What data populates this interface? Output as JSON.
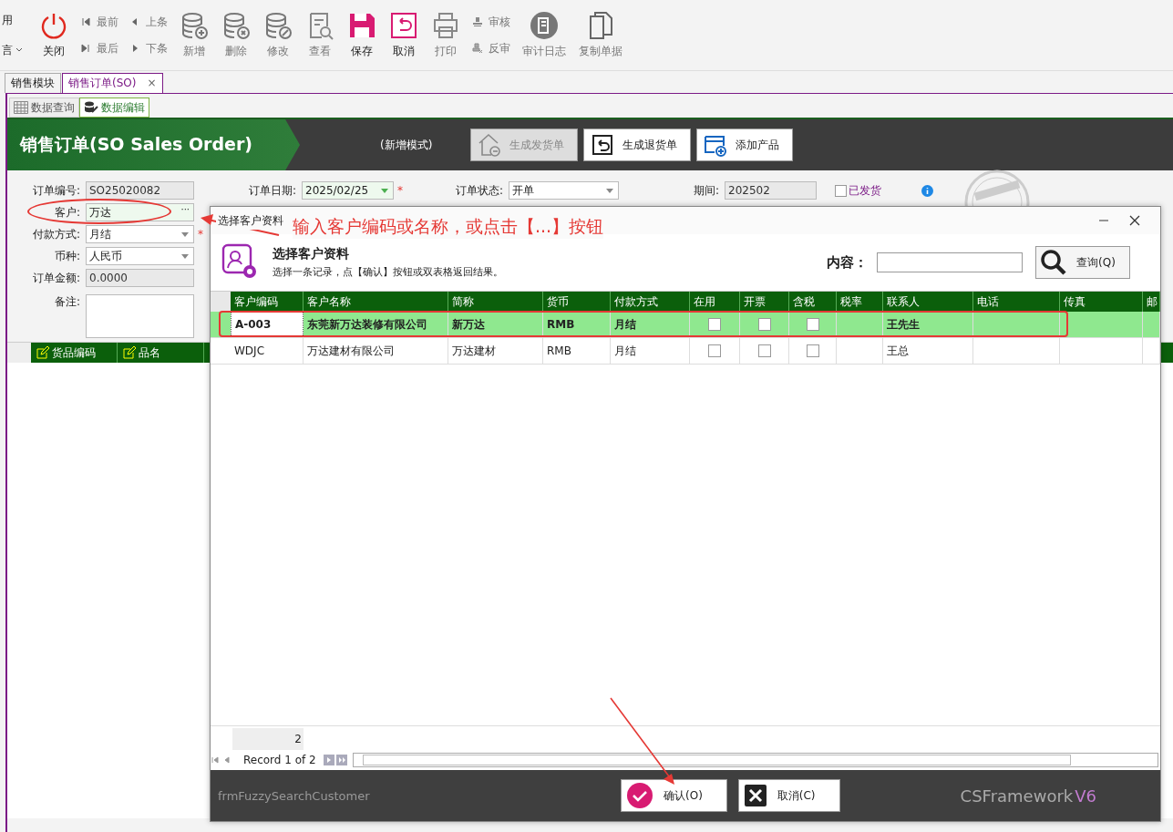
{
  "toolbar": {
    "side_menu": [
      {
        "label": "用",
        "kind": "plain"
      },
      {
        "label": "言",
        "kind": "dropdown"
      }
    ],
    "buttons": [
      {
        "label": "关闭",
        "kind": "power",
        "disabled": false
      },
      {
        "kind": "pair",
        "items": [
          {
            "label": "最前",
            "kind": "first"
          },
          {
            "label": "最后",
            "kind": "last"
          }
        ],
        "disabled": true
      },
      {
        "kind": "pair",
        "items": [
          {
            "label": "上条",
            "kind": "prev"
          },
          {
            "label": "下条",
            "kind": "next"
          }
        ],
        "disabled": true
      },
      {
        "label": "新增",
        "kind": "db-add",
        "disabled": true
      },
      {
        "label": "删除",
        "kind": "db-del",
        "disabled": true
      },
      {
        "label": "修改",
        "kind": "db-edit",
        "disabled": true
      },
      {
        "label": "查看",
        "kind": "view",
        "disabled": true
      },
      {
        "label": "保存",
        "kind": "save",
        "disabled": false
      },
      {
        "label": "取消",
        "kind": "undo",
        "disabled": false
      },
      {
        "label": "打印",
        "kind": "print",
        "disabled": true
      },
      {
        "kind": "pair",
        "items": [
          {
            "label": "审核",
            "kind": "stamp"
          },
          {
            "label": "反审",
            "kind": "unstamp"
          }
        ],
        "disabled": true
      },
      {
        "label": "审计日志",
        "kind": "log",
        "disabled": true
      },
      {
        "label": "复制单据",
        "kind": "copy",
        "disabled": true
      }
    ]
  },
  "doc_tabs": [
    {
      "label": "销售模块",
      "selected": false
    },
    {
      "label": "销售订单(SO)",
      "selected": true,
      "close": "×"
    }
  ],
  "sub_tabs": [
    {
      "label": "数据查询",
      "kind": "grid",
      "selected": false
    },
    {
      "label": "数据编辑",
      "kind": "edit",
      "selected": true
    }
  ],
  "header": {
    "title": "销售订单(SO Sales Order)",
    "mode": "(新增模式)",
    "actions": [
      {
        "label": "生成发货单",
        "kind": "ship",
        "disabled": true
      },
      {
        "label": "生成退货单",
        "kind": "return",
        "disabled": false
      },
      {
        "label": "添加产品",
        "kind": "add",
        "disabled": false
      }
    ]
  },
  "form": {
    "left": [
      {
        "label": "订单编号:",
        "value": "SO25020082",
        "kind": "readonly"
      },
      {
        "label": "客户:",
        "value": "万达",
        "kind": "lookup",
        "button": "···"
      },
      {
        "label": "付款方式:",
        "value": "月结",
        "kind": "dropdown",
        "required": "*"
      },
      {
        "label": "币种:",
        "value": "人民币",
        "kind": "dropdown"
      },
      {
        "label": "订单金额:",
        "value": "0.0000",
        "kind": "readonly"
      },
      {
        "label": "备注:",
        "kind": "memo"
      }
    ],
    "top": [
      {
        "label": "订单日期:",
        "value": "2025/02/25",
        "kind": "date",
        "required": "*"
      },
      {
        "label": "订单状态:",
        "value": "开单",
        "kind": "dropdown"
      },
      {
        "label": "期间:",
        "value": "202502",
        "kind": "readonly"
      }
    ],
    "shipped": {
      "label": "已发货",
      "checked": false
    }
  },
  "item_grid": {
    "columns": [
      "货品编码",
      "品名"
    ]
  },
  "dialog": {
    "title": "选择客户资料",
    "heading": "选择客户资料",
    "hint": "选择一条记录，点【确认】按钮或双表格返回结果。",
    "search_label": "内容：",
    "search_button": "查询(Q)",
    "columns": [
      "客户编码",
      "客户名称",
      "简称",
      "货币",
      "付款方式",
      "在用",
      "开票",
      "含税",
      "税率",
      "联系人",
      "电话",
      "传真",
      "邮"
    ],
    "rows": [
      {
        "selected": true,
        "code": "A-003",
        "name": "东莞新万达装修有限公司",
        "short": "新万达",
        "currency": "RMB",
        "payment": "月结",
        "in_use": false,
        "invoice": false,
        "tax": false,
        "contact": "王先生"
      },
      {
        "selected": false,
        "code": "WDJC",
        "name": "万达建材有限公司",
        "short": "万达建材",
        "currency": "RMB",
        "payment": "月结",
        "in_use": false,
        "invoice": false,
        "tax": false,
        "contact": "王总"
      }
    ],
    "count": "2",
    "record": "Record 1 of 2",
    "form_name": "frmFuzzySearchCustomer",
    "ok": "确认(O)",
    "cancel": "取消(C)",
    "brand": "CSFramework",
    "version": "V6"
  },
  "annotation": "输入客户编码或名称，或点击【...】按钮"
}
